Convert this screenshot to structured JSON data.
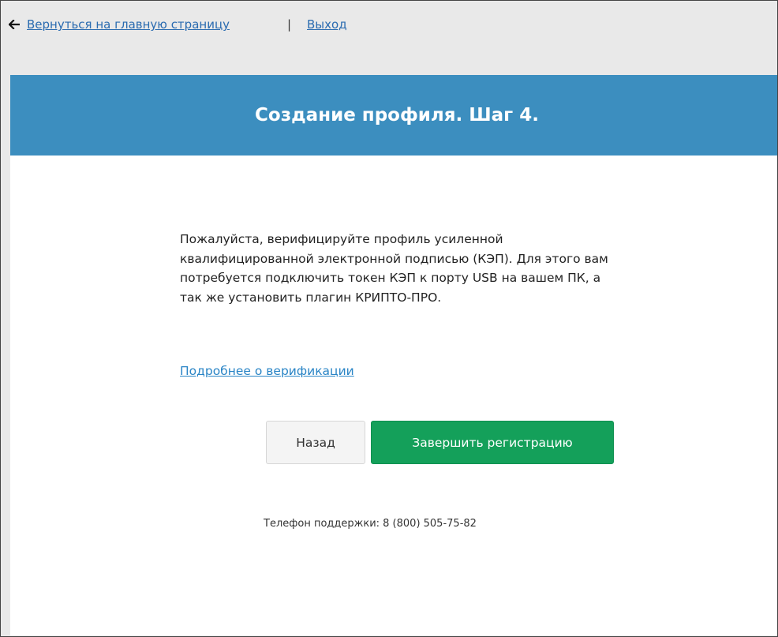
{
  "topbar": {
    "back_arrow_icon": "arrow-left-icon",
    "home_link": "Вернуться на главную страницу",
    "separator": "|",
    "logout_link": "Выход"
  },
  "header": {
    "title": "Создание профиля. Шаг 4.",
    "background_color": "#3c8ebf"
  },
  "main": {
    "description": "Пожалуйста, верифицируйте профиль усиленной квалифицированной электронной подписью (КЭП). Для этого вам потребуется подключить токен КЭП к порту USB на вашем ПК, а так же установить плагин КРИПТО-ПРО.",
    "more_link": "Подробнее о верификации",
    "back_button": "Назад",
    "finish_button": "Завершить регистрацию",
    "finish_button_color": "#14a05a",
    "support_text": "Телефон поддержки: 8 (800) 505-75-82"
  }
}
